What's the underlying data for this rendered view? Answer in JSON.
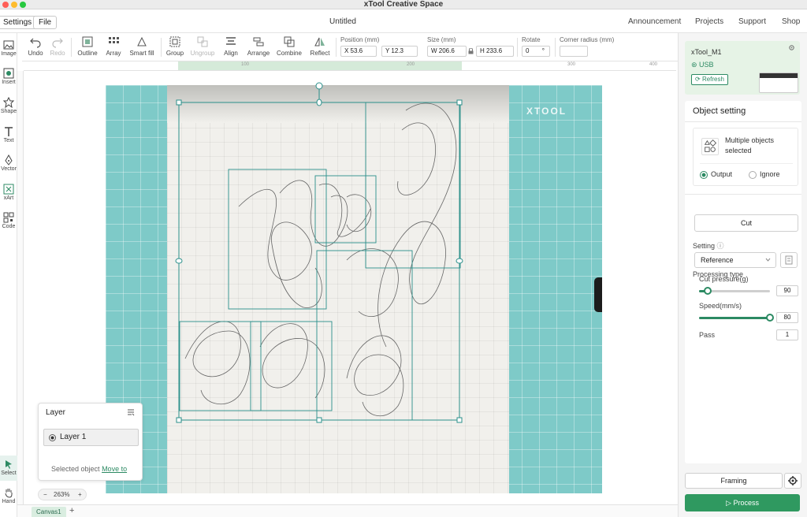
{
  "app": {
    "title": "xTool Creative Space",
    "document_title": "Untitled"
  },
  "menu": {
    "settings": "Settings",
    "file": "File"
  },
  "topnav": [
    "Announcement",
    "Projects",
    "Support",
    "Shop"
  ],
  "toolbar": {
    "undo": "Undo",
    "redo": "Redo",
    "outline": "Outline",
    "array": "Array",
    "smart_fill": "Smart fill",
    "group": "Group",
    "ungroup": "Ungroup",
    "align": "Align",
    "arrange": "Arrange",
    "combine": "Combine",
    "reflect": "Reflect",
    "position_label": "Position (mm)",
    "x_value": "X 53.6",
    "y_value": "Y 12.3",
    "size_label": "Size (mm)",
    "w_value": "W 206.6",
    "h_value": "H 233.6",
    "rotate_label": "Rotate",
    "rotate_value": "0",
    "rotate_unit": "°",
    "corner_label": "Corner radius (mm)",
    "corner_value": ""
  },
  "sidebar": {
    "items": [
      {
        "label": "Image"
      },
      {
        "label": "Insert"
      },
      {
        "label": "Shape"
      },
      {
        "label": "Text"
      },
      {
        "label": "Vector"
      },
      {
        "label": "xArt"
      },
      {
        "label": "Code"
      }
    ],
    "bottom": [
      {
        "label": "Select"
      },
      {
        "label": "Hand"
      }
    ]
  },
  "ruler": {
    "marks": [
      "100",
      "200",
      "300",
      "400"
    ]
  },
  "canvas": {
    "mat_brand": "XTOOL"
  },
  "layer_panel": {
    "title": "Layer",
    "layer_name": "Layer 1",
    "footer_text": "Selected object",
    "footer_link": "Move to"
  },
  "zoom": {
    "minus": "−",
    "value": "263%",
    "plus": "+"
  },
  "tabs": {
    "canvas": "Canvas1",
    "add": "+"
  },
  "device": {
    "name": "xTool_M1",
    "connection": "USB",
    "refresh": "Refresh"
  },
  "object_setting": {
    "title": "Object setting",
    "description": "Multiple objects selected",
    "output": "Output",
    "ignore": "Ignore",
    "output_selected": true,
    "processing_type_label": "Processing type",
    "processing_type": "Cut",
    "setting_label": "Setting",
    "setting_value": "Reference",
    "cut_pressure_label": "Cut pressure(g)",
    "cut_pressure": "90",
    "cut_pressure_fraction": 0.12,
    "speed_label": "Speed(mm/s)",
    "speed": "80",
    "speed_fraction": 1.0,
    "pass_label": "Pass",
    "pass": "1"
  },
  "footer_buttons": {
    "framing": "Framing",
    "process": "Process"
  },
  "colors": {
    "accent": "#2f9960",
    "mat": "#7ecac8",
    "selection": "#2a8f8a"
  }
}
